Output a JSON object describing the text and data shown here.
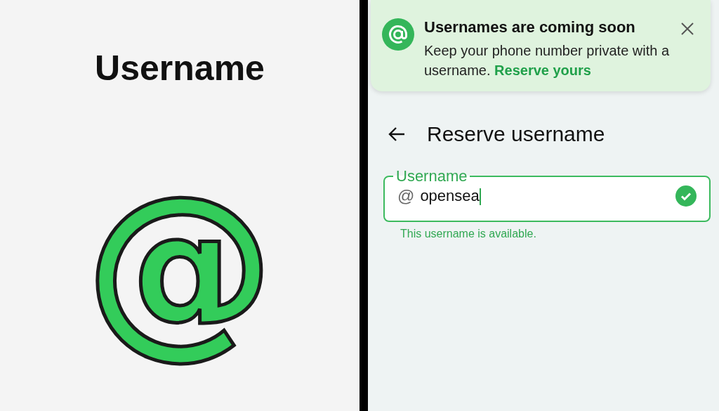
{
  "promo": {
    "heading": "Username",
    "symbol": "@"
  },
  "banner": {
    "title": "Usernames are coming soon",
    "body": "Keep your phone number private with a username.",
    "link": "Reserve yours"
  },
  "app_bar": {
    "title": "Reserve username"
  },
  "field": {
    "label": "Username",
    "prefix": "@",
    "value": "opensea",
    "focused": true,
    "valid": true,
    "helper": "This username is available."
  }
}
